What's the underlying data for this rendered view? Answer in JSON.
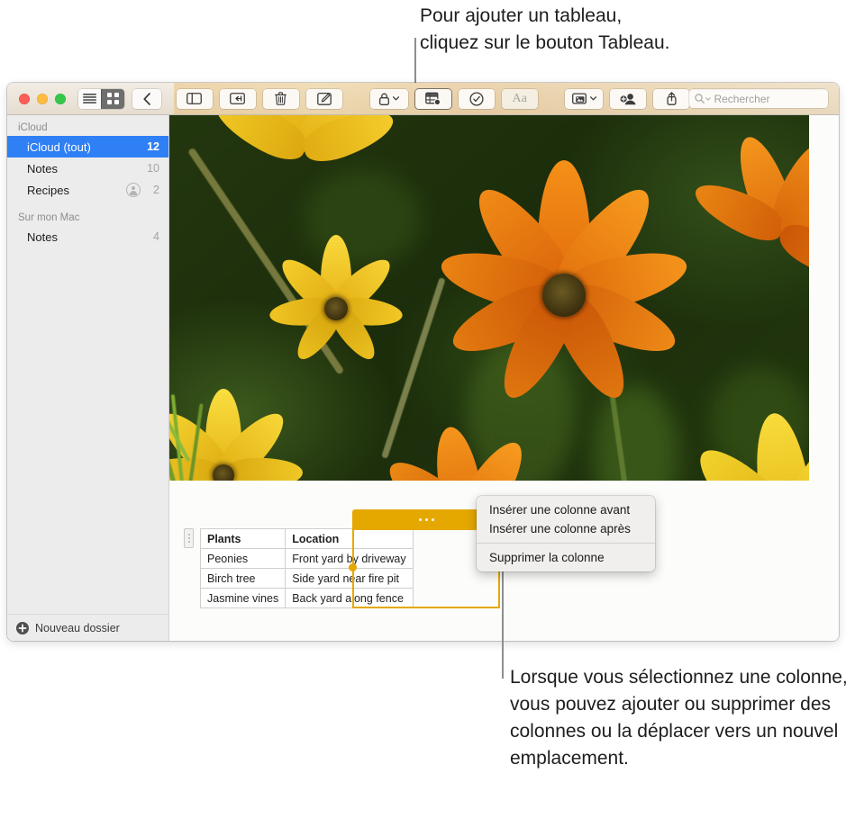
{
  "callouts": {
    "top": "Pour ajouter un tableau,\ncliquez sur le bouton Tableau.",
    "bottom": "Lorsque vous sélectionnez une colonne, vous pouvez ajouter ou supprimer des colonnes ou la déplacer vers un nouvel emplacement."
  },
  "window": {
    "traffic_lights": {
      "close": "close-button",
      "minimize": "minimize-button",
      "zoom": "zoom-button"
    }
  },
  "toolbar": {
    "view_modes": [
      {
        "id": "list",
        "icon": "list-view-icon",
        "selected": false
      },
      {
        "id": "grid",
        "icon": "grid-view-icon",
        "selected": true
      }
    ],
    "back_icon": "chevron-left-icon",
    "buttons": [
      {
        "id": "sidebar-toggle",
        "icon": "sidebar-icon",
        "label": ""
      },
      {
        "id": "folder-move",
        "icon": "move-to-folder-icon",
        "label": ""
      },
      {
        "id": "delete",
        "icon": "trash-icon",
        "label": ""
      },
      {
        "id": "compose",
        "icon": "compose-note-icon",
        "label": ""
      },
      {
        "id": "lock",
        "icon": "lock-icon",
        "label": ""
      },
      {
        "id": "table",
        "icon": "table-icon",
        "label": ""
      },
      {
        "id": "checklist",
        "icon": "checklist-icon",
        "label": ""
      },
      {
        "id": "format",
        "icon": "text-format-icon",
        "label": "Aa"
      },
      {
        "id": "media",
        "icon": "media-icon",
        "label": ""
      },
      {
        "id": "add-people",
        "icon": "add-person-icon",
        "label": ""
      },
      {
        "id": "share",
        "icon": "share-icon",
        "label": ""
      }
    ],
    "search": {
      "icon": "search-icon",
      "placeholder": "Rechercher",
      "value": ""
    }
  },
  "sidebar": {
    "groups": [
      {
        "title": "iCloud",
        "items": [
          {
            "label": "iCloud (tout)",
            "count": "12",
            "selected": true,
            "shared": false
          },
          {
            "label": "Notes",
            "count": "10",
            "selected": false,
            "shared": false
          },
          {
            "label": "Recipes",
            "count": "2",
            "selected": false,
            "shared": true
          }
        ]
      },
      {
        "title": "Sur mon Mac",
        "items": [
          {
            "label": "Notes",
            "count": "4",
            "selected": false,
            "shared": false
          }
        ]
      }
    ],
    "new_folder": {
      "label": "Nouveau dossier",
      "icon": "plus-circle-icon"
    }
  },
  "note": {
    "photo_alt": "orange-and-yellow-daisies-photo",
    "table": {
      "handle_icon": "column-handle-icon",
      "selected_column_index": 1,
      "columns": [
        "Plants",
        "Location"
      ],
      "rows": [
        [
          "Peonies",
          "Front yard by driveway"
        ],
        [
          "Birch tree",
          "Side yard near fire pit"
        ],
        [
          "Jasmine vines",
          "Back yard along fence"
        ]
      ]
    }
  },
  "context_menu": {
    "groups": [
      [
        "Insérer une colonne avant",
        "Insérer une colonne après"
      ],
      [
        "Supprimer la colonne"
      ]
    ]
  },
  "colors": {
    "selection_blue": "#2f7ff5",
    "table_gold": "#e5a800",
    "toolbar_bg": "#ece5da",
    "sidebar_bg": "#ececec"
  }
}
